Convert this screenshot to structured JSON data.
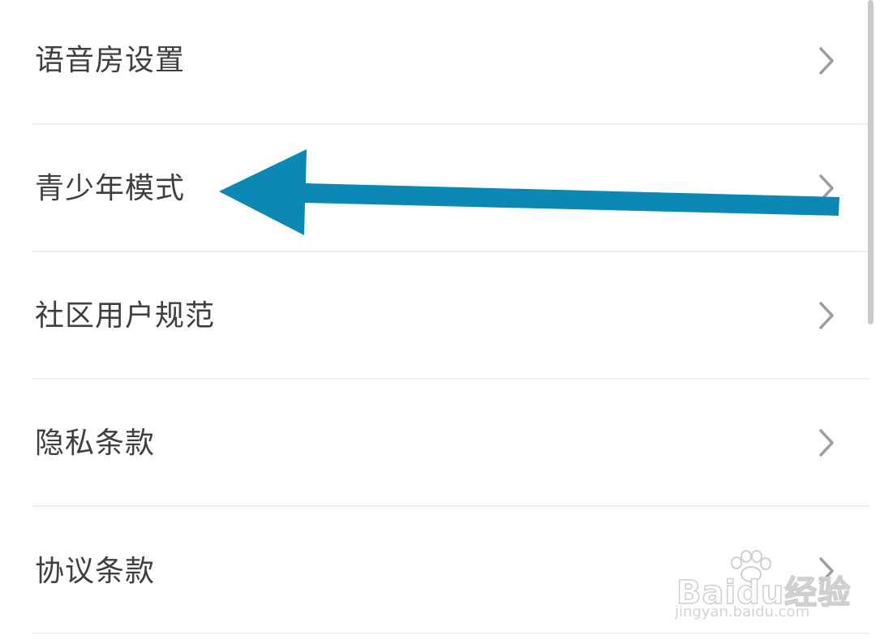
{
  "settings": {
    "items": [
      {
        "label": "语音房设置",
        "icon": "chevron-right-icon"
      },
      {
        "label": "青少年模式",
        "icon": "chevron-right-icon"
      },
      {
        "label": "社区用户规范",
        "icon": "chevron-right-icon"
      },
      {
        "label": "隐私条款",
        "icon": "chevron-right-icon"
      },
      {
        "label": "协议条款",
        "icon": "chevron-right-icon"
      }
    ]
  },
  "annotation": {
    "arrow_color": "#0b88b3",
    "points_to": "青少年模式"
  },
  "watermark": {
    "logo": "Baidu经验",
    "url": "jingyan.baidu.com"
  },
  "colors": {
    "text": "#3f3f3f",
    "chevron": "#9e9e9e",
    "divider": "#eeeeee",
    "scrollbar": "#c9c9c9"
  }
}
